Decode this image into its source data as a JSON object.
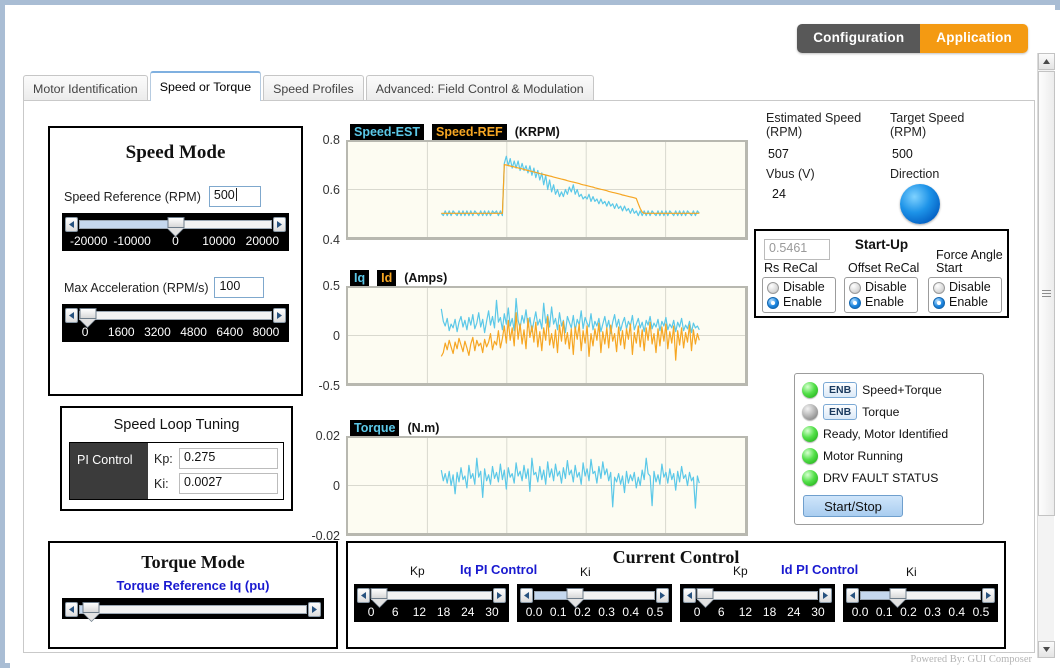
{
  "header": {
    "mode_config": "Configuration",
    "mode_application": "Application"
  },
  "tabs": [
    {
      "label": "Motor Identification",
      "active": false
    },
    {
      "label": "Speed or Torque",
      "active": true
    },
    {
      "label": "Speed Profiles",
      "active": false
    },
    {
      "label": "Advanced: Field Control & Modulation",
      "active": false
    }
  ],
  "speed_mode": {
    "title": "Speed Mode",
    "speed_reference_label": "Speed Reference (RPM)",
    "speed_reference_value": "500",
    "speed_slider_ticks": [
      "-20000",
      "-10000",
      "0",
      "10000",
      "20000"
    ],
    "speed_slider_pos_pct": 50,
    "max_accel_label": "Max Acceleration (RPM/s)",
    "max_accel_value": "100",
    "accel_slider_ticks": [
      "0",
      "1600",
      "3200",
      "4800",
      "6400",
      "8000"
    ],
    "accel_slider_pos_pct": 3
  },
  "speed_tuning": {
    "title": "Speed Loop Tuning",
    "pi_control_label": "PI Control",
    "kp_label": "Kp:",
    "kp_value": "0.275",
    "ki_label": "Ki:",
    "ki_value": "0.0027"
  },
  "torque_mode": {
    "title": "Torque Mode",
    "reference_label": "Torque Reference Iq (pu)",
    "slider_pos_pct": 4
  },
  "readouts": {
    "estimated_speed_label": "Estimated Speed (RPM)",
    "estimated_speed_value": "507",
    "target_speed_label": "Target Speed (RPM)",
    "target_speed_value": "500",
    "vbus_label": "Vbus (V)",
    "vbus_value": "24",
    "direction_label": "Direction",
    "direction_led_color": "#1d93e8"
  },
  "startup": {
    "title": "Start-Up",
    "readonly_value": "0.5461",
    "groups": [
      {
        "label": "Rs ReCal",
        "disable_label": "Disable",
        "enable_label": "Enable",
        "selected": "Enable"
      },
      {
        "label": "Offset ReCal",
        "disable_label": "Disable",
        "enable_label": "Enable",
        "selected": "Enable"
      },
      {
        "label": "Force Angle Start",
        "disable_label": "Disable",
        "enable_label": "Enable",
        "selected": "Enable"
      }
    ]
  },
  "status_panel": {
    "rows": [
      {
        "led": "green",
        "button": "ENB",
        "label": "Speed+Torque"
      },
      {
        "led": "gray",
        "button": "ENB",
        "label": "Torque"
      },
      {
        "led": "green",
        "button": null,
        "label": "Ready, Motor Identified"
      },
      {
        "led": "green",
        "button": null,
        "label": "Motor Running"
      },
      {
        "led": "green",
        "button": null,
        "label": "DRV FAULT STATUS"
      }
    ],
    "start_stop_label": "Start/Stop"
  },
  "current_control": {
    "title": "Current Control",
    "iq_pi_label": "Iq PI Control",
    "id_pi_label": "Id PI Control",
    "kp_label": "Kp",
    "ki_label": "Ki",
    "iq_kp_ticks": [
      "0",
      "6",
      "12",
      "18",
      "24",
      "30"
    ],
    "iq_kp_pos_pct": 5,
    "iq_ki_ticks": [
      "0.0",
      "0.1",
      "0.2",
      "0.3",
      "0.4",
      "0.5"
    ],
    "iq_ki_pos_pct": 33,
    "id_kp_ticks": [
      "0",
      "6",
      "12",
      "18",
      "24",
      "30"
    ],
    "id_kp_pos_pct": 5,
    "id_ki_ticks": [
      "0.0",
      "0.1",
      "0.2",
      "0.3",
      "0.4",
      "0.5"
    ],
    "id_ki_pos_pct": 30
  },
  "footer": {
    "text": "Powered By: GUI Composer"
  },
  "chart_data": [
    {
      "type": "line",
      "name": "speed-chart",
      "title": "",
      "unit": "(KRPM)",
      "ylabel": "",
      "xlabel": "",
      "ylim": [
        0.4,
        0.8
      ],
      "yticks": [
        0.4,
        0.6,
        0.8
      ],
      "grid": true,
      "legend": [
        {
          "name": "Speed-EST",
          "color": "#5bc8e8"
        },
        {
          "name": "Speed-REF",
          "color": "#f6a623"
        }
      ],
      "series": [
        {
          "name": "Speed-EST",
          "color": "#5bc8e8",
          "values": [
            0.5,
            0.49,
            0.51,
            0.49,
            0.51,
            0.49,
            0.51,
            0.5,
            0.49,
            0.51,
            0.49,
            0.51,
            0.49,
            0.51,
            0.49,
            0.51,
            0.49,
            0.51,
            0.5,
            0.49,
            0.51,
            0.49,
            0.51,
            0.49,
            0.51,
            0.49,
            0.51,
            0.5,
            0.51,
            0.49,
            0.51,
            0.49,
            0.71,
            0.74,
            0.7,
            0.73,
            0.69,
            0.72,
            0.69,
            0.72,
            0.68,
            0.71,
            0.68,
            0.7,
            0.67,
            0.7,
            0.66,
            0.69,
            0.65,
            0.68,
            0.64,
            0.67,
            0.62,
            0.66,
            0.6,
            0.64,
            0.59,
            0.62,
            0.58,
            0.6,
            0.57,
            0.59,
            0.57,
            0.6,
            0.58,
            0.61,
            0.59,
            0.62,
            0.58,
            0.6,
            0.57,
            0.58,
            0.56,
            0.57,
            0.56,
            0.58,
            0.55,
            0.57,
            0.55,
            0.56,
            0.54,
            0.56,
            0.54,
            0.55,
            0.53,
            0.55,
            0.53,
            0.54,
            0.52,
            0.54,
            0.52,
            0.53,
            0.51,
            0.53,
            0.51,
            0.52,
            0.5,
            0.52,
            0.5,
            0.51,
            0.49,
            0.51,
            0.49,
            0.51,
            0.49,
            0.51,
            0.49,
            0.51,
            0.5,
            0.49,
            0.51,
            0.49,
            0.51,
            0.49,
            0.51,
            0.49,
            0.51,
            0.5,
            0.49,
            0.51,
            0.49,
            0.51,
            0.49,
            0.51,
            0.49,
            0.51,
            0.5,
            0.49,
            0.51,
            0.49,
            0.51,
            0.5
          ]
        },
        {
          "name": "Speed-REF",
          "color": "#f6a623",
          "values": [
            0.5,
            0.5,
            0.5,
            0.5,
            0.5,
            0.5,
            0.5,
            0.5,
            0.5,
            0.5,
            0.5,
            0.5,
            0.5,
            0.5,
            0.5,
            0.5,
            0.5,
            0.5,
            0.5,
            0.5,
            0.5,
            0.5,
            0.5,
            0.5,
            0.5,
            0.5,
            0.5,
            0.5,
            0.5,
            0.5,
            0.5,
            0.5,
            0.705,
            0.703,
            0.701,
            0.699,
            0.697,
            0.695,
            0.693,
            0.691,
            0.689,
            0.687,
            0.684,
            0.682,
            0.68,
            0.678,
            0.676,
            0.674,
            0.672,
            0.67,
            0.667,
            0.665,
            0.663,
            0.661,
            0.659,
            0.657,
            0.655,
            0.652,
            0.65,
            0.648,
            0.646,
            0.644,
            0.642,
            0.64,
            0.637,
            0.635,
            0.633,
            0.631,
            0.629,
            0.627,
            0.625,
            0.622,
            0.62,
            0.618,
            0.616,
            0.614,
            0.612,
            0.61,
            0.607,
            0.605,
            0.603,
            0.601,
            0.599,
            0.597,
            0.595,
            0.592,
            0.59,
            0.588,
            0.586,
            0.584,
            0.582,
            0.58,
            0.577,
            0.575,
            0.573,
            0.571,
            0.569,
            0.567,
            0.565,
            0.562,
            0.54,
            0.52,
            0.505,
            0.5,
            0.5,
            0.5,
            0.5,
            0.5,
            0.5,
            0.5,
            0.5,
            0.5,
            0.5,
            0.5,
            0.5,
            0.5,
            0.5,
            0.5,
            0.5,
            0.5,
            0.5,
            0.5,
            0.5,
            0.5,
            0.5,
            0.5,
            0.5,
            0.5,
            0.5,
            0.5,
            0.5,
            0.5
          ]
        }
      ]
    },
    {
      "type": "line",
      "name": "current-chart",
      "title": "",
      "unit": "(Amps)",
      "ylim": [
        -0.5,
        0.5
      ],
      "yticks": [
        -0.5,
        0.0,
        0.5
      ],
      "grid": true,
      "legend": [
        {
          "name": "Iq",
          "color": "#5bc8e8"
        },
        {
          "name": "Id",
          "color": "#f6a623"
        }
      ],
      "series": [
        {
          "name": "Iq",
          "color": "#5bc8e8",
          "values": [
            0.28,
            0.15,
            0.1,
            0.18,
            0.05,
            0.12,
            0.08,
            0.17,
            0.04,
            0.14,
            0.2,
            0.09,
            0.16,
            0.06,
            0.19,
            0.11,
            0.22,
            0.07,
            0.13,
            0.24,
            0.09,
            0.17,
            0.03,
            0.15,
            0.26,
            0.11,
            0.2,
            0.08,
            0.37,
            0.14,
            0.19,
            0.06,
            0.23,
            0.12,
            0.29,
            0.1,
            0.18,
            0.05,
            0.39,
            0.16,
            0.08,
            0.21,
            0.13,
            0.27,
            0.09,
            0.19,
            0.04,
            0.15,
            0.25,
            0.11,
            0.17,
            0.07,
            0.34,
            0.13,
            0.22,
            0.09,
            0.3,
            0.12,
            0.18,
            0.06,
            0.24,
            0.1,
            0.16,
            0.03,
            0.2,
            0.14,
            0.08,
            0.21,
            0.05,
            0.17,
            0.11,
            0.26,
            0.07,
            0.19,
            0.13,
            0.09,
            0.23,
            0.06,
            0.15,
            0.1,
            0.18,
            0.04,
            0.12,
            0.2,
            0.08,
            0.16,
            0.02,
            0.14,
            0.22,
            0.09,
            0.17,
            0.05,
            0.13,
            0.19,
            0.07,
            0.15,
            0.1,
            0.21,
            0.06,
            0.12,
            0.18,
            0.08,
            0.14,
            0.04,
            0.16,
            0.11,
            0.2,
            0.07,
            0.13,
            0.09,
            0.17,
            0.05,
            0.15,
            0.1,
            0.19,
            0.06,
            0.12,
            0.08,
            0.16,
            0.04,
            0.14,
            0.09,
            0.18,
            0.05,
            0.11,
            0.07,
            0.15,
            0.03,
            0.13,
            0.08,
            0.1,
            0.06
          ]
        },
        {
          "name": "Id",
          "color": "#f6a623",
          "values": [
            -0.22,
            -0.18,
            -0.08,
            -0.15,
            -0.05,
            -0.12,
            -0.19,
            -0.07,
            -0.14,
            -0.03,
            -0.1,
            -0.17,
            -0.06,
            -0.13,
            -0.21,
            -0.09,
            -0.02,
            -0.16,
            -0.05,
            -0.11,
            -0.08,
            -0.18,
            -0.04,
            -0.12,
            -0.07,
            0.02,
            -0.15,
            -0.06,
            -0.1,
            0.05,
            -0.13,
            -0.03,
            0.1,
            -0.08,
            0.16,
            -0.05,
            0.08,
            -0.11,
            0.24,
            -0.04,
            0.12,
            -0.09,
            0.06,
            -0.14,
            0.18,
            -0.02,
            0.1,
            -0.07,
            0.14,
            -0.12,
            0.04,
            -0.16,
            0.08,
            -0.05,
            0.2,
            -0.1,
            0.02,
            -0.13,
            0.06,
            -0.18,
            0.11,
            -0.06,
            0.15,
            -0.09,
            0.03,
            -0.14,
            0.07,
            -0.2,
            0.09,
            -0.04,
            0.12,
            -0.16,
            0.05,
            -0.08,
            0.1,
            -0.22,
            0.02,
            -0.11,
            0.07,
            -0.05,
            0.13,
            -0.18,
            0.04,
            -0.09,
            0.08,
            -0.13,
            0.11,
            -0.06,
            0.02,
            -0.17,
            0.09,
            -0.1,
            0.05,
            -0.14,
            0.07,
            -0.04,
            0.12,
            -0.2,
            0.03,
            -0.08,
            0.1,
            -0.12,
            0.06,
            -0.16,
            0.08,
            -0.05,
            0.14,
            -0.09,
            0.02,
            -0.18,
            0.07,
            -0.11,
            0.09,
            -0.06,
            0.12,
            -0.14,
            0.04,
            -0.08,
            0.1,
            -0.26,
            0.05,
            -0.1,
            0.08,
            -0.13,
            0.03,
            -0.07,
            0.11,
            -0.16,
            0.06,
            -0.09,
            0.02,
            -0.05
          ]
        }
      ]
    },
    {
      "type": "line",
      "name": "torque-chart",
      "title": "",
      "unit": "(N.m)",
      "ylim": [
        -0.02,
        0.02
      ],
      "yticks": [
        -0.02,
        0.0,
        0.02
      ],
      "grid": true,
      "legend": [
        {
          "name": "Torque",
          "color": "#5bc8e8"
        }
      ],
      "series": [
        {
          "name": "Torque",
          "color": "#5bc8e8",
          "values": [
            0.0065,
            0.002,
            0.005,
            0.001,
            0.006,
            0.0,
            0.0045,
            -0.0035,
            0.0055,
            0.0015,
            0.0075,
            0.0025,
            0.004,
            -0.001,
            0.0085,
            0.003,
            0.005,
            0.0005,
            0.0115,
            0.0035,
            0.006,
            -0.005,
            0.007,
            0.002,
            0.0045,
            0.0005,
            0.008,
            0.003,
            0.0055,
            0.0015,
            0.009,
            0.0025,
            0.0065,
            -0.0015,
            0.0075,
            0.0035,
            0.005,
            0.001,
            0.0095,
            0.004,
            0.006,
            0.002,
            0.0085,
            0.003,
            0.007,
            -0.0025,
            0.0115,
            0.0045,
            0.0055,
            0.0015,
            0.008,
            0.0025,
            0.0065,
            0.0005,
            0.01,
            0.0035,
            0.007,
            0.002,
            0.009,
            0.004,
            0.006,
            0.001,
            0.0075,
            0.003,
            0.0105,
            0.0045,
            0.0065,
            0.0015,
            0.0085,
            0.0035,
            0.0055,
            0.0005,
            0.0095,
            0.004,
            0.007,
            0.002,
            0.011,
            0.005,
            0.006,
            0.001,
            0.008,
            0.003,
            0.01,
            0.0045,
            0.007,
            0.002,
            0.0055,
            -0.009,
            0.0035,
            0.0015,
            0.005,
            0.0005,
            0.004,
            -0.003,
            0.006,
            0.001,
            0.0045,
            0.002,
            0.0055,
            -0.001,
            0.0035,
            0.0,
            0.0065,
            0.0025,
            0.0115,
            0.005,
            0.004,
            -0.0085,
            0.006,
            0.0015,
            0.0045,
            0.0005,
            0.009,
            0.0035,
            0.0055,
            0.001,
            0.007,
            0.0025,
            0.005,
            -0.002,
            0.006,
            0.0015,
            0.008,
            0.003,
            0.0045,
            0.0,
            0.0055,
            0.002,
            0.0035,
            -0.0095,
            0.004,
            0.001
          ]
        }
      ]
    }
  ]
}
